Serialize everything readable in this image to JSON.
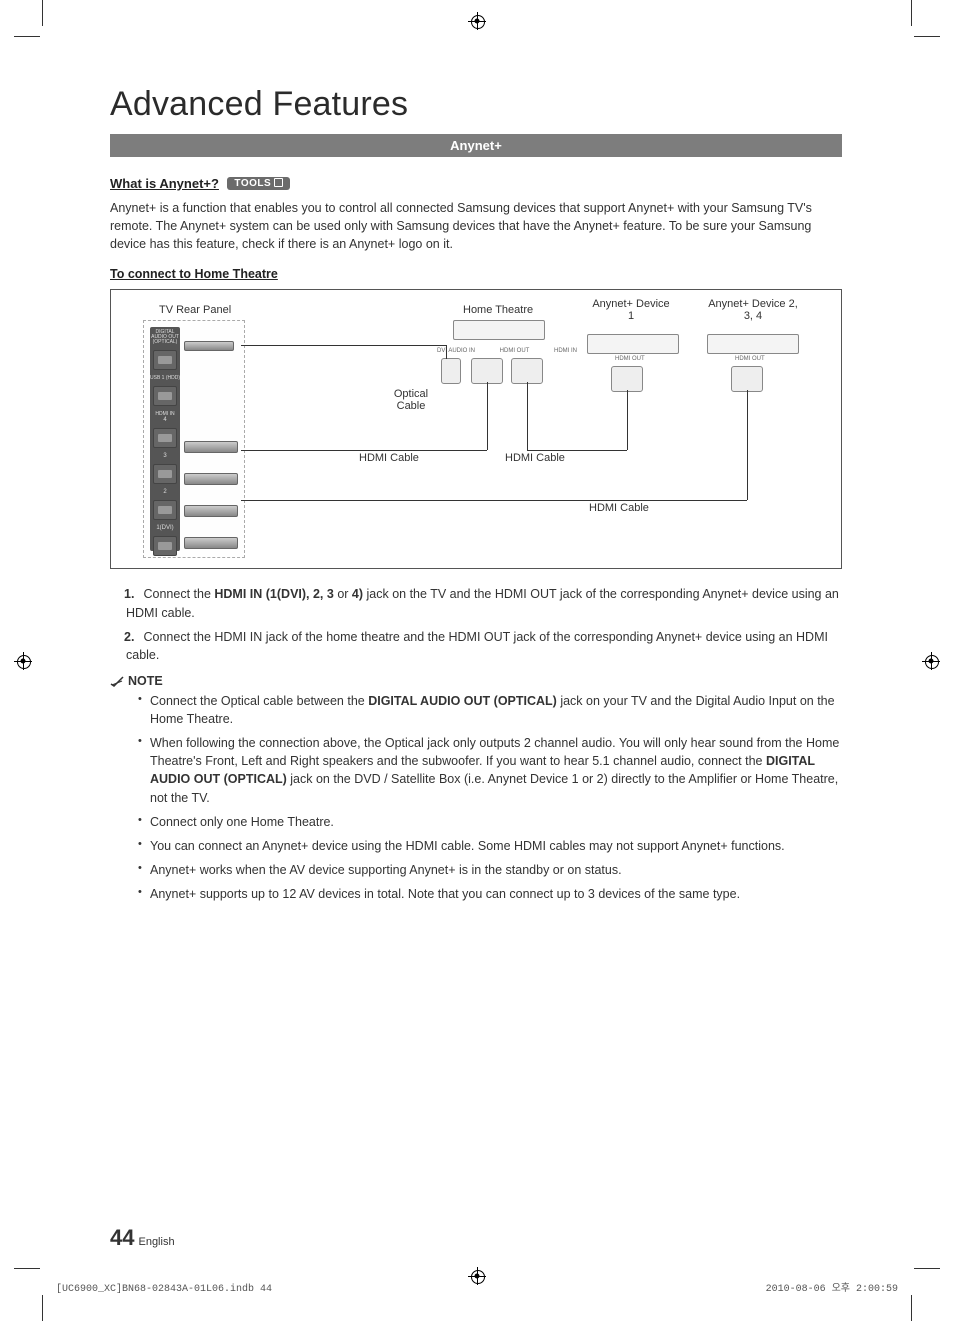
{
  "header": {
    "title": "Advanced Features"
  },
  "section": {
    "banner": "Anynet+"
  },
  "what": {
    "heading": "What is Anynet+?",
    "badge": "TOOLS",
    "intro": "Anynet+ is a function that enables you to control all connected Samsung devices that support Anynet+ with your Samsung TV's remote. The Anynet+ system can be used only with Samsung devices that have the Anynet+ feature. To be sure your Samsung device has this feature, check if there is an Anynet+ logo on it."
  },
  "connect": {
    "heading": "To connect to Home Theatre",
    "diagram": {
      "tv_rear_panel": "TV Rear Panel",
      "home_theatre": "Home Theatre",
      "anynet_device_1": "Anynet+ Device 1",
      "anynet_device_234": "Anynet+ Device 2, 3, 4",
      "optical_cable": "Optical Cable",
      "hdmi_cable_1": "HDMI Cable",
      "hdmi_cable_2": "HDMI Cable",
      "hdmi_cable_3": "HDMI Cable",
      "ports": {
        "digital_audio_out": "DIGITAL AUDIO OUT (OPTICAL)",
        "usb": "USB 1 (HDD)",
        "hdmi_in": "HDMI IN",
        "dvi_audio_in": "DVI AUDIO IN",
        "hdmi_out": "HDMI OUT",
        "hdmi_in_port": "HDMI IN",
        "n4": "4",
        "n3": "3",
        "n2": "2",
        "n1": "1(DVI)"
      }
    }
  },
  "steps": {
    "s1_pre": "Connect the ",
    "s1_bold": "HDMI IN (1(DVI), 2, 3",
    "s1_mid": " or ",
    "s1_bold2": "4)",
    "s1_post": " jack on the TV and the HDMI OUT jack of the corresponding Anynet+ device using an HDMI cable.",
    "s2": "Connect the HDMI IN jack of the home theatre and the HDMI OUT jack of the corresponding Anynet+ device using an HDMI cable."
  },
  "note": {
    "label": "NOTE",
    "n1_pre": "Connect the Optical cable between the ",
    "n1_bold": "DIGITAL AUDIO OUT (OPTICAL)",
    "n1_post": " jack on your TV and the Digital Audio Input on the Home Theatre.",
    "n2_pre": "When following the connection above, the Optical jack only outputs 2 channel audio. You will only hear sound from the Home Theatre's Front, Left and Right speakers and the subwoofer. If you want to hear 5.1 channel audio, connect the ",
    "n2_bold": "DIGITAL AUDIO OUT (OPTICAL)",
    "n2_post": " jack on the DVD / Satellite Box (i.e. Anynet Device 1 or 2) directly to the Amplifier or Home Theatre, not the TV.",
    "n3": "Connect only one Home Theatre.",
    "n4": "You can connect an Anynet+ device using the HDMI cable. Some HDMI cables may not support Anynet+ functions.",
    "n5": "Anynet+ works when the AV device supporting Anynet+ is in the standby or on status.",
    "n6": "Anynet+ supports up to 12 AV devices in total. Note that you can connect up to 3 devices of the same type."
  },
  "footer": {
    "page_number": "44",
    "language": "English",
    "file_left": "[UC6900_XC]BN68-02843A-01L06.indb   44",
    "file_right": "2010-08-06   오후 2:00:59"
  }
}
